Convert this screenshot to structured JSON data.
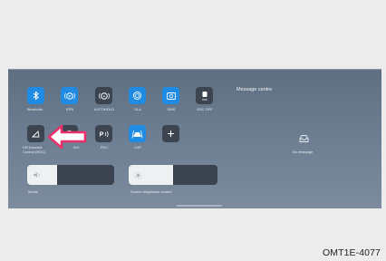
{
  "quick_settings": {
    "row1": [
      {
        "label": "Bluetooth",
        "state": "on",
        "icon": "bluetooth-icon"
      },
      {
        "label": "EPB",
        "state": "on",
        "icon": "epb-icon"
      },
      {
        "label": "AUTOHOLD",
        "state": "off",
        "icon": "autohold-icon"
      },
      {
        "label": "SLA",
        "state": "on",
        "icon": "sla-icon"
      },
      {
        "label": "DMS",
        "state": "on",
        "icon": "dms-icon"
      },
      {
        "label": "ESC OFF",
        "state": "off",
        "icon": "esc-off-icon"
      }
    ],
    "row2": [
      {
        "label": "Hill Descent Control (HDC)",
        "state": "off",
        "icon": "hdc-icon"
      },
      {
        "label": "ISG",
        "state": "off",
        "icon": "isg-icon"
      },
      {
        "label": "PDC",
        "state": "off",
        "icon": "pdc-icon"
      },
      {
        "label": "LDP",
        "state": "on",
        "icon": "ldp-icon"
      },
      {
        "label": "",
        "state": "off",
        "icon": "add-icon"
      }
    ]
  },
  "sliders": {
    "media": {
      "label": "Media",
      "level": 0.34,
      "icon": "speaker-icon"
    },
    "brightness": {
      "label": "Screen brightness control",
      "level": 0.5,
      "icon": "sun-icon"
    }
  },
  "message_centre": {
    "title": "Message centre",
    "empty_text": "No message",
    "icon": "inbox-icon"
  },
  "caption": "OMT1E-4077",
  "colors": {
    "active_tile": "#1f8be3",
    "inactive_tile": "#3c4450",
    "arrow": "#e8316b"
  }
}
